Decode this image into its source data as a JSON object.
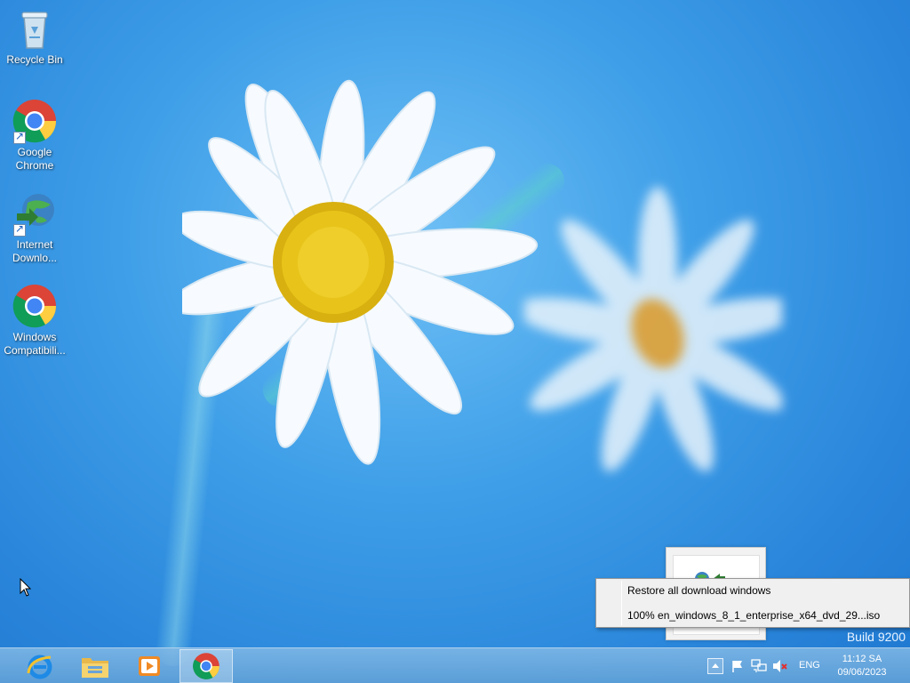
{
  "desktop": {
    "icons": [
      {
        "label_line1": "Recycle Bin",
        "label_line2": ""
      },
      {
        "label_line1": "Google",
        "label_line2": "Chrome"
      },
      {
        "label_line1": "Internet",
        "label_line2": "Downlo..."
      },
      {
        "label_line1": "Windows",
        "label_line2": "Compatibili..."
      }
    ],
    "watermark": "Build 9200"
  },
  "context_menu": {
    "items": [
      {
        "label": "Restore all download windows"
      },
      {
        "label": "100% en_windows_8_1_enterprise_x64_dvd_29...iso"
      }
    ]
  },
  "taskbar": {
    "pinned": [
      {
        "icon": "internet-explorer-icon"
      },
      {
        "icon": "file-explorer-icon"
      },
      {
        "icon": "media-player-icon"
      },
      {
        "icon": "chrome-icon",
        "active": true
      }
    ],
    "tray": {
      "icons": [
        "show-hidden-icons-icon",
        "action-center-flag-icon",
        "network-icon",
        "volume-muted-icon"
      ],
      "language": "ENG",
      "time": "11:12 SA",
      "date": "09/06/2023"
    }
  }
}
